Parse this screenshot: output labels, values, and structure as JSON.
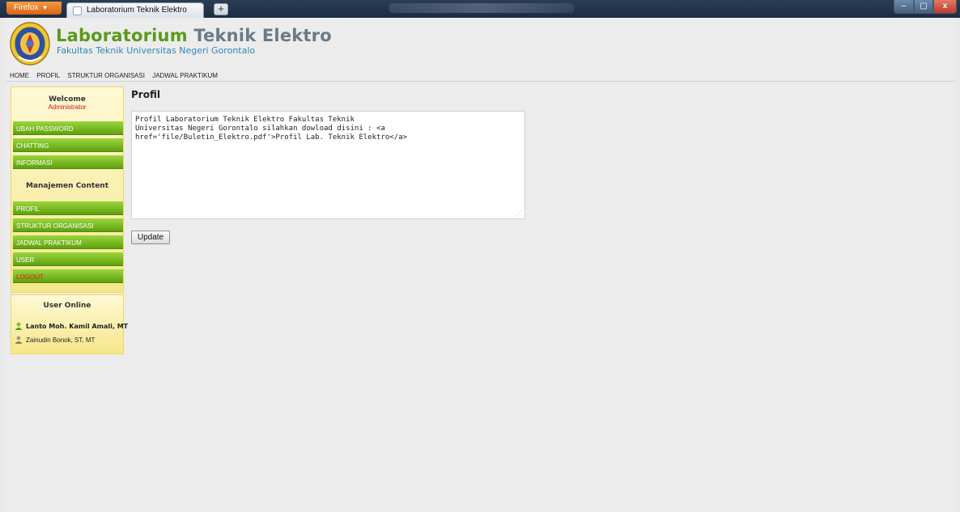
{
  "browser": {
    "menu_label": "Firefox",
    "tab_title": "Laboratorium Teknik Elektro",
    "new_tab": "+",
    "minimize": "–",
    "maximize": "▢",
    "close": "x"
  },
  "header": {
    "title_part1": "Laboratorium",
    "title_part2": "Teknik Elektro",
    "subtitle": "Fakultas Teknik Universitas Negeri Gorontalo",
    "logo_icon": "university-seal-icon"
  },
  "topnav": {
    "items": [
      "HOME",
      "PROFIL",
      "STRUKTUR ORGANISASI",
      "JADWAL PRAKTIKUM"
    ]
  },
  "sidebar": {
    "welcome_heading": "Welcome",
    "role": "Administrator",
    "menu": [
      "UBAH PASSWORD",
      "CHATTING",
      "INFORMASI"
    ],
    "content_heading": "Manajemen Content",
    "content_menu": [
      "PROFIL",
      "STRUKTUR ORGANISASI",
      "JADWAL PRAKTIKUM",
      "USER",
      "LOGOUT"
    ],
    "online_heading": "User Online",
    "users": [
      "Lanto Moh. Kamil Amali, MT",
      "Zainudin Bonok, ST, MT"
    ]
  },
  "main": {
    "title": "Profil",
    "editor_text": "Profil Laboratorium Teknik Elektro Fakultas Teknik\nUniversitas Negeri Gorontalo silahkan dowload disini : <a\nhref='file/Buletin_Elektro.pdf'>Profil Lab. Teknik Elektro</a>",
    "update_label": "Update"
  },
  "colors": {
    "menu_green": "#6fb31a",
    "sidebar_yellow": "#f6e68a",
    "title_green": "#5c9a1a",
    "subtitle_blue": "#2f87b8",
    "logout_red": "#e02020"
  }
}
